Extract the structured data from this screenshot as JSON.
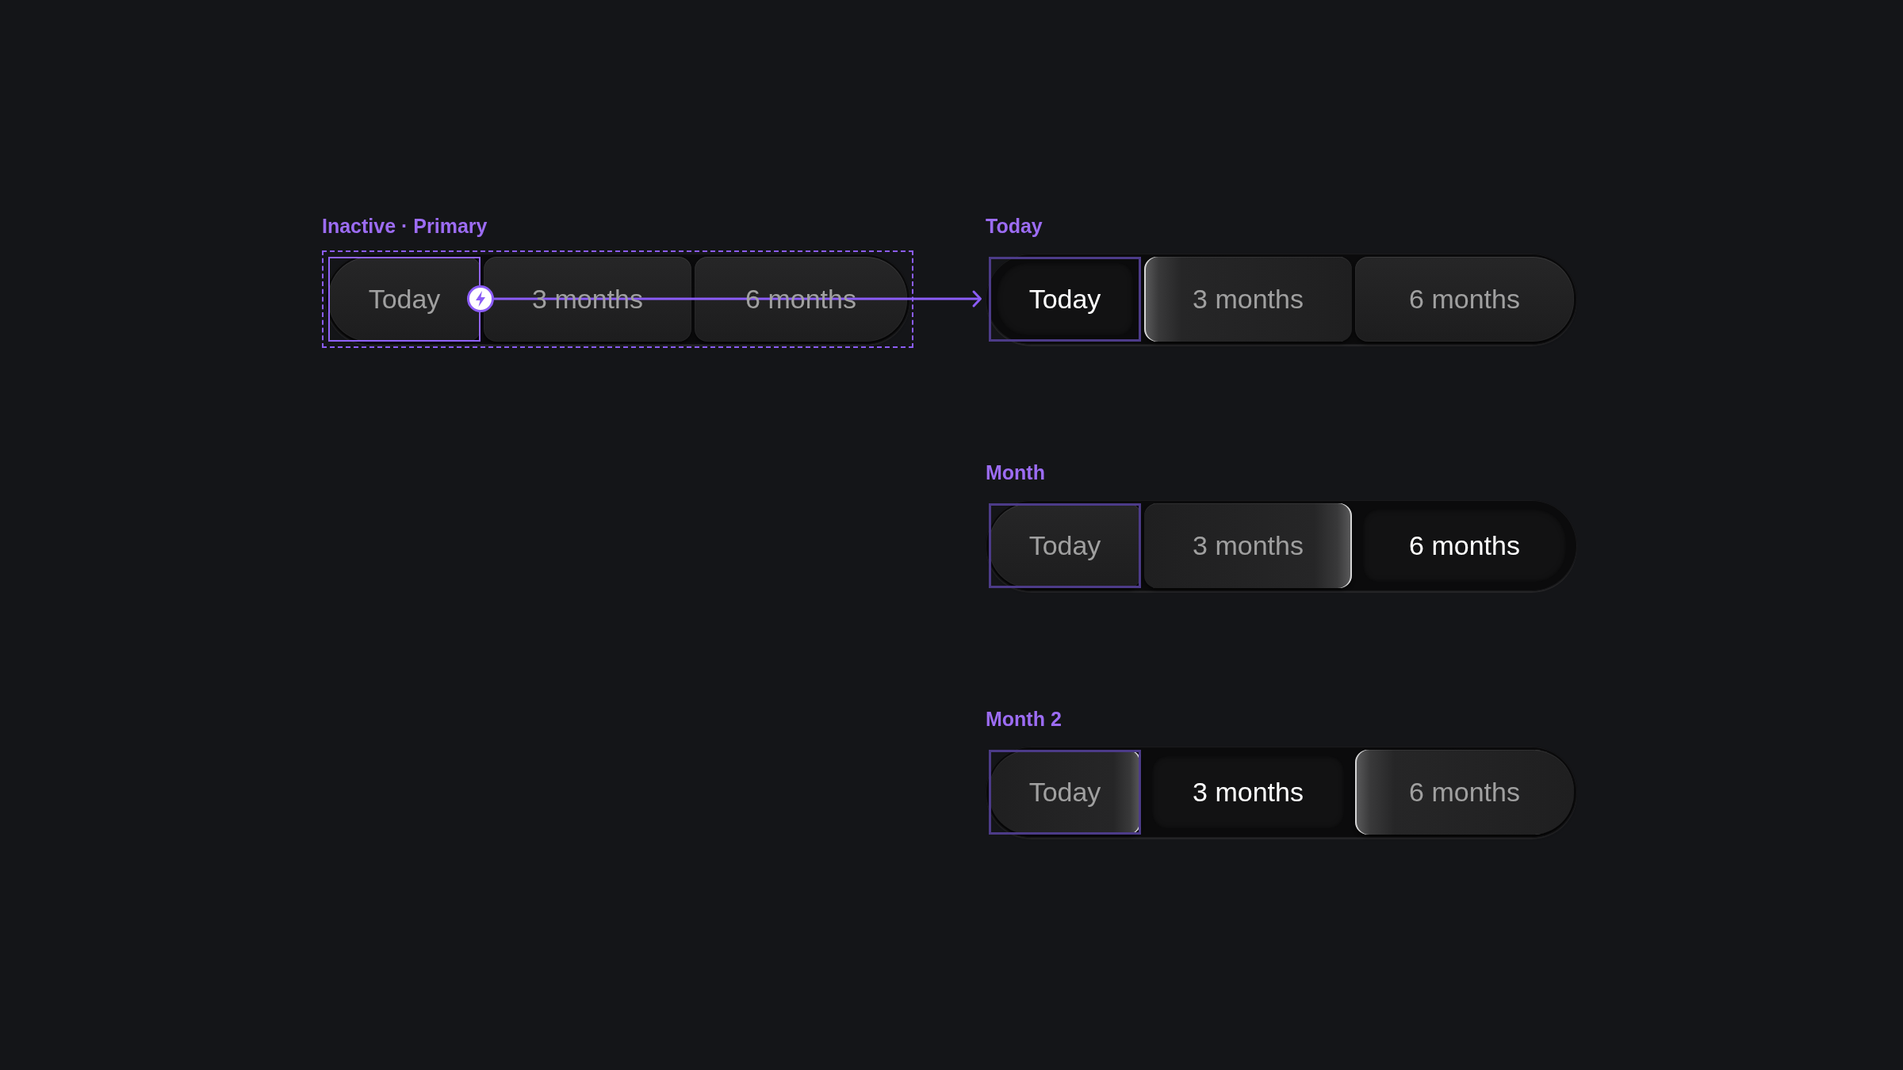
{
  "prototype_source": {
    "label": "Inactive · Primary",
    "selected": true,
    "segments": [
      {
        "label": "Today",
        "selected": false,
        "outlined": true,
        "prototype_link": true
      },
      {
        "label": "3 months",
        "selected": false,
        "outlined": false,
        "prototype_link": false
      },
      {
        "label": "6 months",
        "selected": false,
        "outlined": false,
        "prototype_link": false
      }
    ]
  },
  "variants": [
    {
      "label": "Today",
      "selected": false,
      "segments": [
        {
          "label": "Today",
          "selected": true,
          "outlined": true
        },
        {
          "label": "3 months",
          "selected": false,
          "outlined": false
        },
        {
          "label": "6 months",
          "selected": false,
          "outlined": false
        }
      ]
    },
    {
      "label": "Month",
      "selected": false,
      "segments": [
        {
          "label": "Today",
          "selected": false,
          "outlined": true
        },
        {
          "label": "3 months",
          "selected": false,
          "outlined": false
        },
        {
          "label": "6 months",
          "selected": true,
          "outlined": false
        }
      ]
    },
    {
      "label": "Month 2",
      "selected": false,
      "segments": [
        {
          "label": "Today",
          "selected": false,
          "outlined": true
        },
        {
          "label": "3 months",
          "selected": true,
          "outlined": false
        },
        {
          "label": "6 months",
          "selected": false,
          "outlined": false
        }
      ]
    }
  ]
}
